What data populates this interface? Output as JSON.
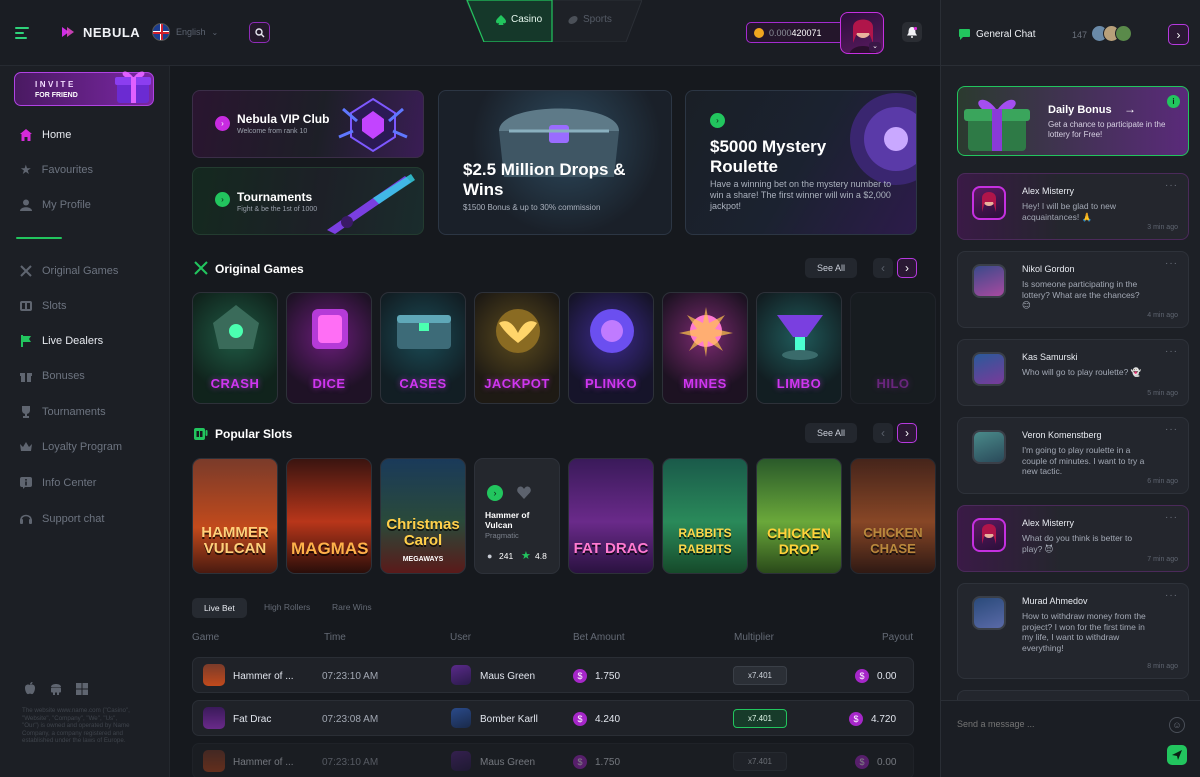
{
  "brand": {
    "name": "NEBULA"
  },
  "header": {
    "language": "English",
    "tabs": [
      {
        "label": "Casino"
      },
      {
        "label": "Sports"
      }
    ],
    "balance_prefix": "0.000",
    "balance_value": "420071"
  },
  "invite": {
    "line1": "INVITE",
    "line2": "FOR FRIEND"
  },
  "nav": {
    "home": "Home",
    "favourites": "Favourites",
    "profile": "My Profile",
    "original_games": "Original Games",
    "slots": "Slots",
    "live_dealers": "Live Dealers",
    "bonuses": "Bonuses",
    "tournaments": "Tournaments",
    "loyalty": "Loyalty Program",
    "info": "Info Center",
    "support": "Support chat"
  },
  "footer_legal": "The website www.name.com (\"Casino\", \"Website\", \"Company\", \"We\", \"Us\", \"Our\") is owned and operated by Name Company, a company registered and established under the laws of Europe.",
  "promos": {
    "vip": {
      "title": "Nebula VIP Club",
      "sub": "Welcome from rank 10"
    },
    "tournaments": {
      "title": "Tournaments",
      "sub": "Fight & be the 1st of 1000"
    },
    "drops": {
      "title": "$2.5 Million Drops & Wins",
      "sub": "$1500 Bonus & up to 30% commission"
    },
    "roulette": {
      "title": "$5000 Mystery Roulette",
      "sub": "Have a winning bet on the mystery number to win a share! The first winner will win a $2,000 jackpot!"
    }
  },
  "original_games": {
    "title": "Original Games",
    "see_all": "See All",
    "items": [
      "CRASH",
      "DICE",
      "CASES",
      "JACKPOT",
      "PLINKO",
      "MINES",
      "LIMBO",
      "HILO"
    ]
  },
  "popular_slots": {
    "title": "Popular Slots",
    "see_all": "See All",
    "items": [
      {
        "title": "HAMMER VULCAN"
      },
      {
        "title": "MAGMAS"
      },
      {
        "title": "Christmas Carol",
        "sub": "MEGAWAYS"
      },
      {
        "title": "Hammer of Vulcan",
        "provider": "Pragmatic",
        "players": "241",
        "rating": "4.8"
      },
      {
        "title": "FAT DRAC"
      },
      {
        "title": "RABBITS RABBITS"
      },
      {
        "title": "CHICKEN DROP"
      },
      {
        "title": "CHICKEN CHASE"
      }
    ]
  },
  "bets": {
    "tabs": [
      "Live Bet",
      "High Rollers",
      "Rare Wins"
    ],
    "columns": [
      "Game",
      "Time",
      "User",
      "Bet Amount",
      "Multiplier",
      "Payout"
    ],
    "rows": [
      {
        "game": "Hammer of ...",
        "time": "07:23:10 AM",
        "user": "Maus Green",
        "bet": "1.750",
        "multiplier": "x7.401",
        "payout": "0.00",
        "win": false
      },
      {
        "game": "Fat Drac",
        "time": "07:23:08 AM",
        "user": "Bomber Karll",
        "bet": "4.240",
        "multiplier": "x7.401",
        "payout": "4.720",
        "win": true
      },
      {
        "game": "Hammer of ...",
        "time": "07:23:10 AM",
        "user": "Maus Green",
        "bet": "1.750",
        "multiplier": "x7.401",
        "payout": "0.00",
        "win": false
      }
    ]
  },
  "chat": {
    "title": "General Chat",
    "online": "147",
    "daily_bonus": {
      "title": "Daily Bonus",
      "text": "Get a chance to participate in the lottery for Free!"
    },
    "messages": [
      {
        "name": "Alex Misterry",
        "text": "Hey! I will be glad to new acquaintances! 🙏",
        "time": "3 min ago"
      },
      {
        "name": "Nikol Gordon",
        "text": "Is someone participating in the lottery? What are the chances? 😊",
        "time": "4 min ago"
      },
      {
        "name": "Kas Samurski",
        "text": "Who will go to play roulette? 👻",
        "time": "5 min ago"
      },
      {
        "name": "Veron Komenstberg",
        "text": "I'm going to play roulette in a couple of minutes. I want to try a new tactic.",
        "time": "6 min ago"
      },
      {
        "name": "Alex Misterry",
        "text": "What do you think is better to play? 😈",
        "time": "7 min ago"
      },
      {
        "name": "Murad Ahmedov",
        "text": "How to withdraw money from the project? I won for the first time in my life, I want to withdraw everything!",
        "time": "8 min ago"
      }
    ],
    "input_placeholder": "Send a message ..."
  },
  "colors": {
    "accent": "#a42bd0",
    "green": "#22c55e",
    "bg": "#16191e"
  }
}
